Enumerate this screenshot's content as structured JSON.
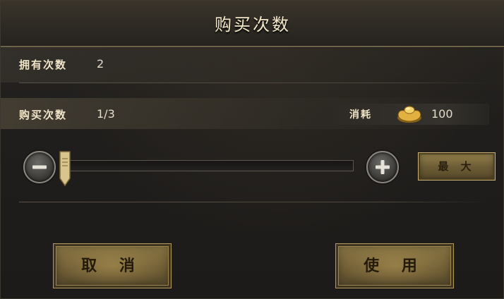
{
  "dialog": {
    "title": "购买次数"
  },
  "owned": {
    "label": "拥有次数",
    "value": "2"
  },
  "purchase": {
    "label": "购买次数",
    "value": "1/3",
    "slider_fraction": 0.0
  },
  "cost": {
    "label": "消耗",
    "icon": "gold-ingot-icon",
    "value": "100"
  },
  "controls": {
    "minus_icon": "minus-icon",
    "plus_icon": "plus-icon",
    "max_label": "最 大"
  },
  "actions": {
    "cancel_label": "取 消",
    "use_label": "使 用"
  }
}
